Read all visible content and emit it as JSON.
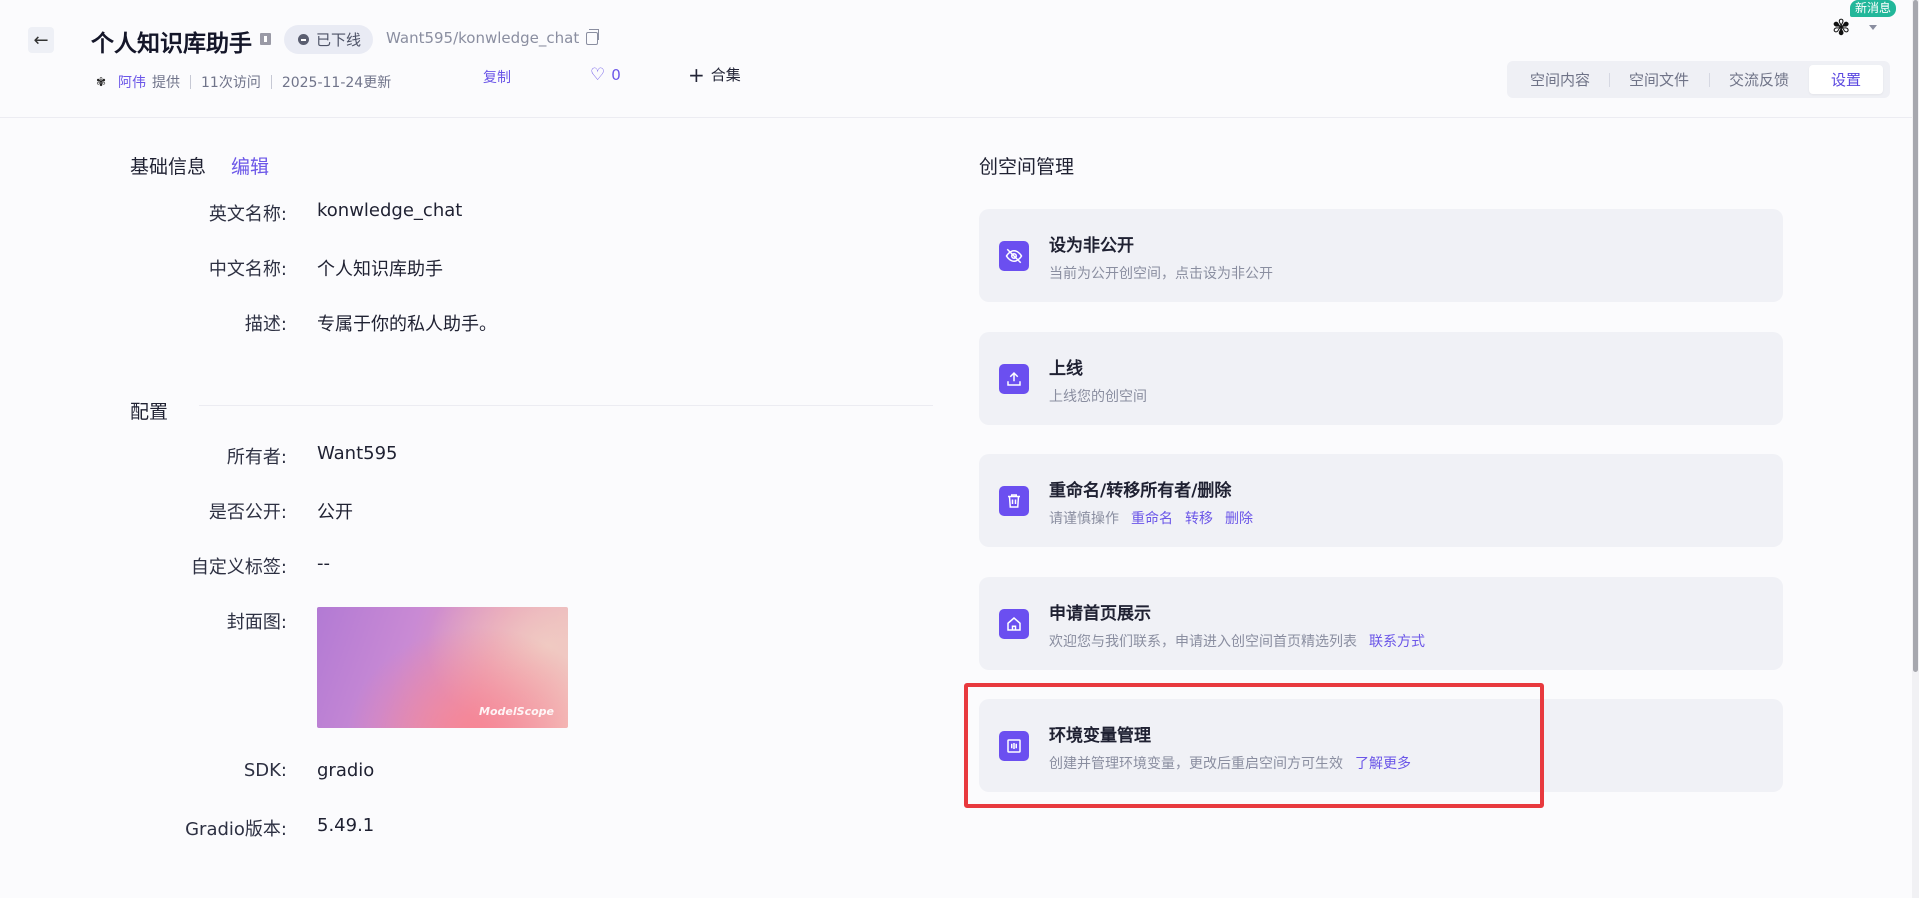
{
  "header": {
    "title": "个人知识库助手",
    "status": "已下线",
    "repo_path": "Want595/konwledge_chat",
    "author": "阿伟",
    "provided": "提供",
    "visits": "11次访问",
    "updated": "2025-11-24更新",
    "copy_label": "复制",
    "likes": "0",
    "collection_label": "合集",
    "new_badge": "新消息"
  },
  "tabs": [
    {
      "label": "空间内容"
    },
    {
      "label": "空间文件"
    },
    {
      "label": "交流反馈"
    },
    {
      "label": "设置",
      "active": true
    }
  ],
  "basic_info": {
    "title": "基础信息",
    "edit_label": "编辑",
    "fields": [
      {
        "label": "英文名称:",
        "value": "konwledge_chat"
      },
      {
        "label": "中文名称:",
        "value": "个人知识库助手"
      },
      {
        "label": "描述:",
        "value": "专属于你的私人助手。"
      }
    ]
  },
  "config": {
    "title": "配置",
    "fields": [
      {
        "label": "所有者:",
        "value": "Want595"
      },
      {
        "label": "是否公开:",
        "value": "公开"
      },
      {
        "label": "自定义标签:",
        "value": "--"
      },
      {
        "label": "封面图:",
        "value": ""
      },
      {
        "label": "SDK:",
        "value": "gradio"
      },
      {
        "label": "Gradio版本:",
        "value": "5.49.1"
      }
    ],
    "cover_watermark": "ModelScope"
  },
  "management": {
    "title": "创空间管理",
    "cards": [
      {
        "title": "设为非公开",
        "desc": "当前为公开创空间，点击设为非公开",
        "icon": "eye-off-icon"
      },
      {
        "title": "上线",
        "desc": "上线您的创空间",
        "icon": "upload-icon"
      },
      {
        "title": "重命名/转移所有者/删除",
        "desc": "请谨慎操作",
        "links": [
          "重命名",
          "转移",
          "删除"
        ],
        "icon": "trash-icon"
      },
      {
        "title": "申请首页展示",
        "desc": "欢迎您与我们联系，申请进入创空间首页精选列表",
        "links": [
          "联系方式"
        ],
        "icon": "home-icon"
      },
      {
        "title": "环境变量管理",
        "desc": "创建并管理环境变量，更改后重启空间方可生效",
        "links": [
          "了解更多"
        ],
        "icon": "env-var-icon"
      }
    ]
  },
  "colors": {
    "accent": "#6b56e8",
    "highlight": "#e8393e",
    "card_bg": "#f0f1f6"
  }
}
